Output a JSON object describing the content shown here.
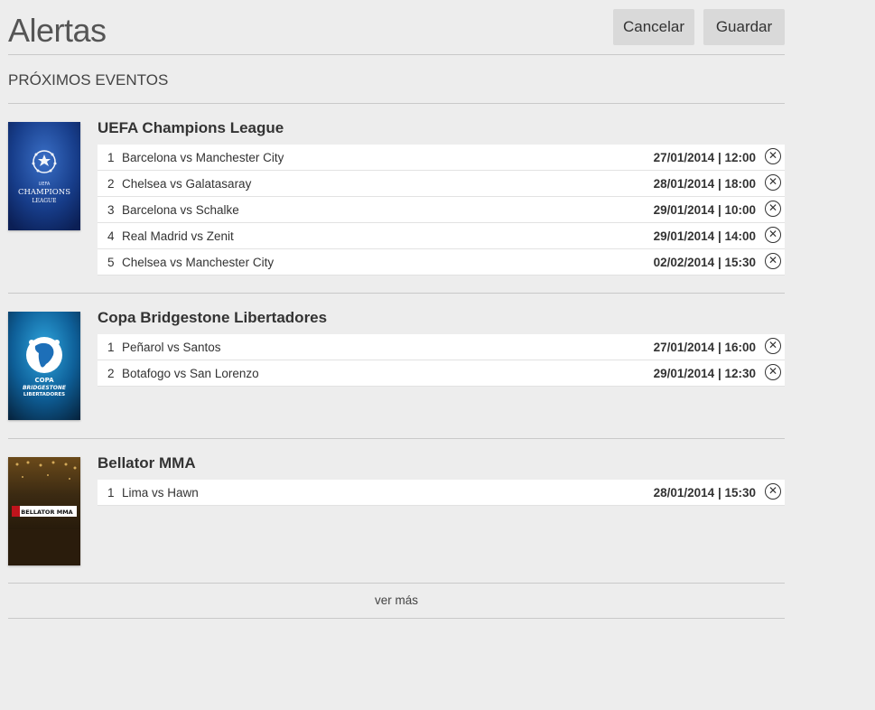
{
  "header": {
    "title": "Alertas",
    "cancel_label": "Cancelar",
    "save_label": "Guardar"
  },
  "section": {
    "title": "PRÓXIMOS EVENTOS"
  },
  "groups": [
    {
      "name": "UEFA Champions League",
      "logo_text": [
        "UEFA",
        "CHAMPIONS",
        "LEAGUE"
      ],
      "events": [
        {
          "num": "1",
          "name": "Barcelona vs Manchester City",
          "date": "27/01/2014 | 12:00"
        },
        {
          "num": "2",
          "name": "Chelsea vs Galatasaray",
          "date": "28/01/2014 | 18:00"
        },
        {
          "num": "3",
          "name": "Barcelona vs Schalke",
          "date": "29/01/2014 | 10:00"
        },
        {
          "num": "4",
          "name": "Real Madrid vs Zenit",
          "date": "29/01/2014 | 14:00"
        },
        {
          "num": "5",
          "name": "Chelsea vs Manchester City",
          "date": "02/02/2014 | 15:30"
        }
      ]
    },
    {
      "name": "Copa Bridgestone Libertadores",
      "logo_text": [
        "COPA",
        "BRIDGESTONE",
        "LIBERTADORES"
      ],
      "events": [
        {
          "num": "1",
          "name": "Peñarol vs Santos",
          "date": "27/01/2014 | 16:00"
        },
        {
          "num": "2",
          "name": "Botafogo vs San Lorenzo",
          "date": "29/01/2014 | 12:30"
        }
      ]
    },
    {
      "name": "Bellator MMA",
      "logo_text": [
        "BELLATOR MMA"
      ],
      "events": [
        {
          "num": "1",
          "name": "Lima vs Hawn",
          "date": "28/01/2014 | 15:30"
        }
      ]
    }
  ],
  "more_link": "ver más",
  "icons": {
    "remove": "close-circle-icon"
  },
  "colors": {
    "background": "#ededed",
    "row_background": "#ffffff",
    "button_background": "#d9d9d9",
    "divider": "#c9c9c9"
  }
}
